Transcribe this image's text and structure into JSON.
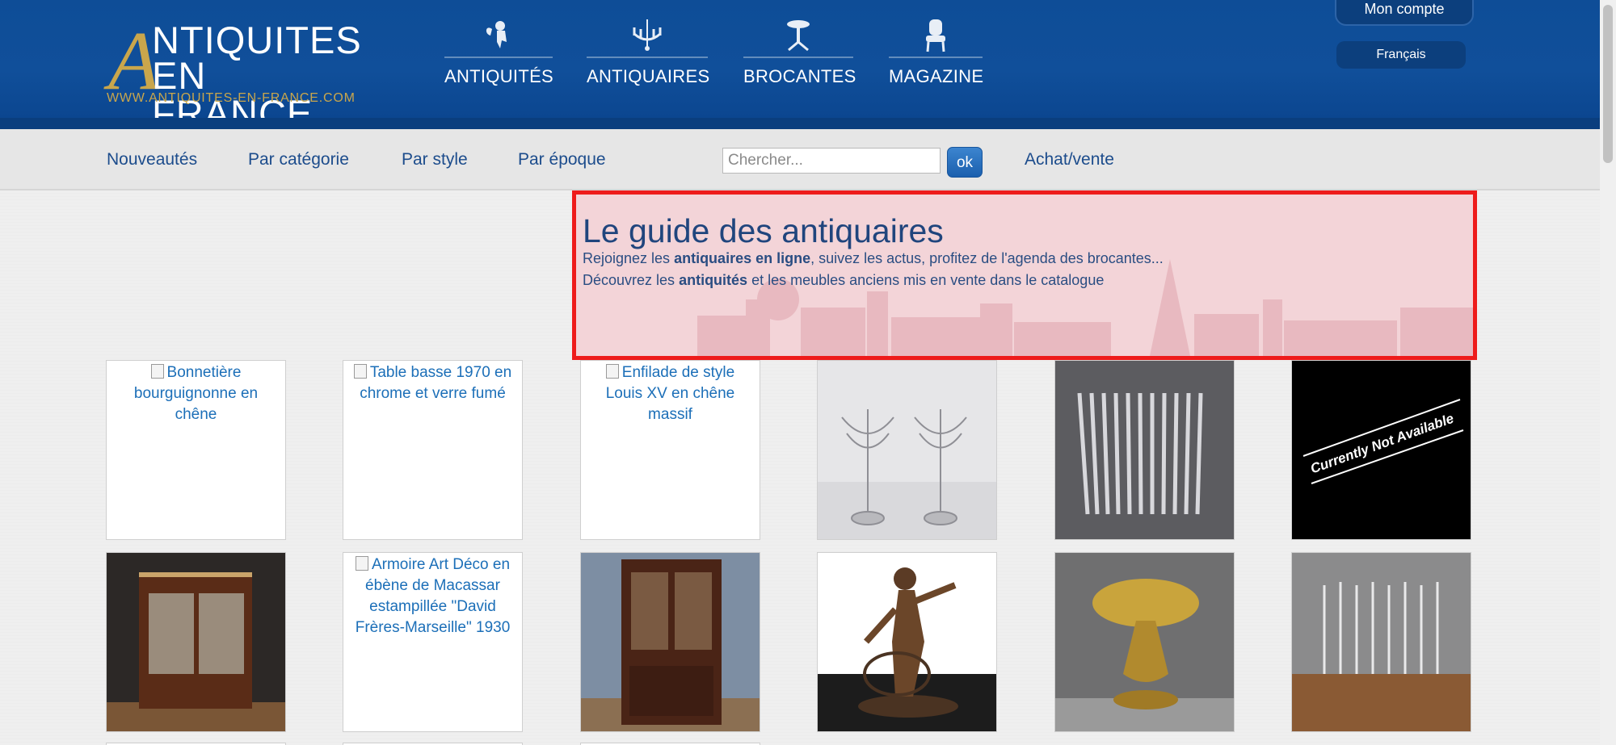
{
  "logo": {
    "first_letter": "A",
    "line1": "NTIQUITES",
    "line2": "EN FRANCE",
    "url": "WWW.ANTIQUITES-EN-FRANCE.COM"
  },
  "main_nav": [
    {
      "label": "ANTIQUITÉS",
      "icon": "cherub-icon"
    },
    {
      "label": "ANTIQUAIRES",
      "icon": "chandelier-icon"
    },
    {
      "label": "BROCANTES",
      "icon": "pedestal-table-icon"
    },
    {
      "label": "MAGAZINE",
      "icon": "armchair-icon"
    }
  ],
  "account": {
    "label": "Mon compte",
    "language": "Français"
  },
  "sub_nav": [
    "Nouveautés",
    "Par catégorie",
    "Par style",
    "Par époque",
    "Achat/vente"
  ],
  "search": {
    "placeholder": "Chercher...",
    "button": "ok"
  },
  "hero": {
    "title": "Le guide des antiquaires",
    "line1_pre": "Rejoignez les ",
    "line1_bold": "antiquaires en ligne",
    "line1_post": ", suivez les actus, profitez de l'agenda des brocantes...",
    "line2_pre": "Découvrez les ",
    "line2_bold": "antiquités",
    "line2_post": " et les meubles anciens mis en vente dans le catalogue"
  },
  "products_row1": [
    {
      "alt": "Bonnetière bourguignonne en chêne",
      "image": "broken"
    },
    {
      "alt": "Table basse 1970 en chrome et verre fumé",
      "image": "broken"
    },
    {
      "alt": "Enfilade de style Louis XV en chêne massif",
      "image": "broken"
    },
    {
      "image": "candelabras-photo"
    },
    {
      "image": "silver-cutlery-photo"
    },
    {
      "image": "currently-not-available",
      "overlay_text": "Currently Not Available"
    }
  ],
  "products_row2": [
    {
      "image": "mahogany-cabinet-photo"
    },
    {
      "alt": "Armoire Art Déco en ébène de Macassar estampillée \"David Frères-Marseille\" 1930",
      "image": "broken"
    },
    {
      "image": "bookcase-photo"
    },
    {
      "image": "bronze-statue-photo"
    },
    {
      "image": "brass-lamp-photo"
    },
    {
      "image": "champagne-flutes-photo"
    }
  ],
  "colors": {
    "header": "#0e4d97",
    "gold": "#c9a64c",
    "link": "#1c4c8c",
    "highlight_border": "#ee1b1b"
  }
}
